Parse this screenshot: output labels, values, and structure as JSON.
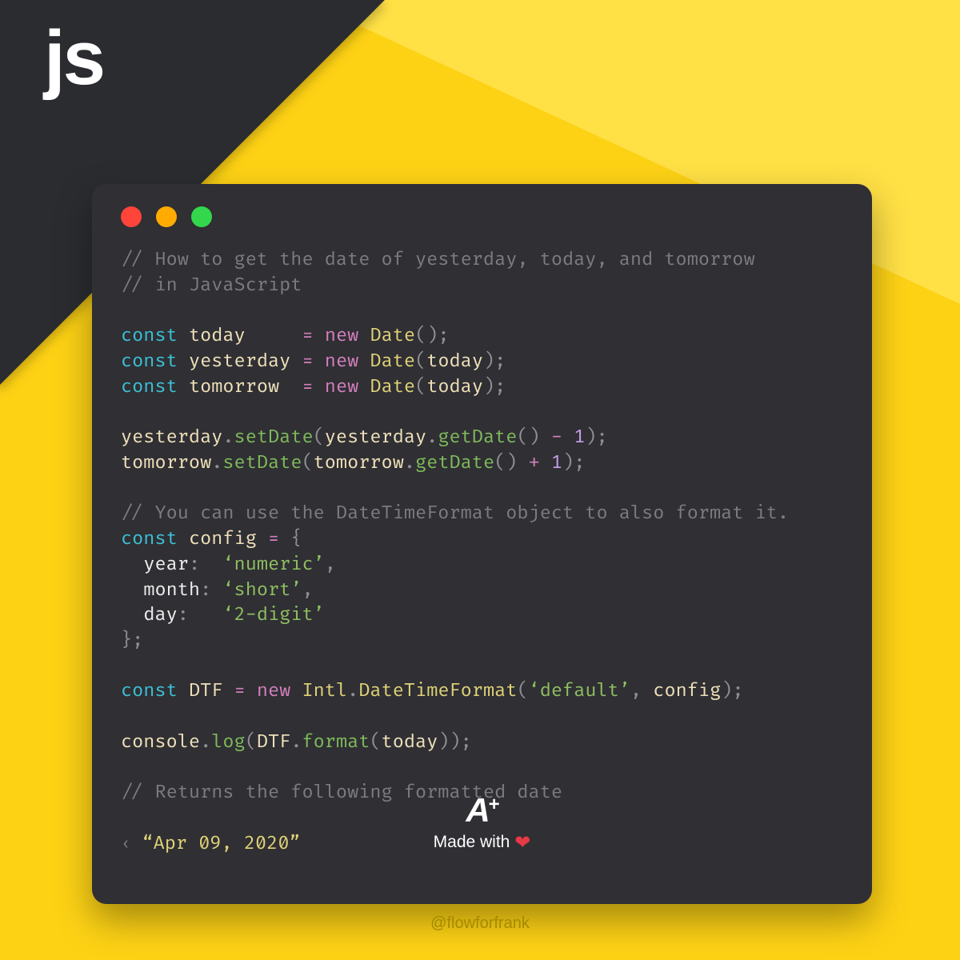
{
  "corner_label": "js",
  "comment1": "// How to get the date of yesterday, today, and tomorrow",
  "comment2": "// in JavaScript",
  "kw_const": "const",
  "id_today": "today",
  "id_yesterday": "yesterday",
  "id_tomorrow": "tomorrow",
  "id_config": "config",
  "id_DTF": "DTF",
  "id_console": "console",
  "id_Intl": "Intl",
  "kw_new": "new",
  "type_Date": "Date",
  "type_DateTimeFormat": "DateTimeFormat",
  "m_setDate": "setDate",
  "m_getDate": "getDate",
  "m_log": "log",
  "m_format": "format",
  "num_1": "1",
  "p_eq": "=",
  "p_minus": "-",
  "p_plus": "+",
  "p_dot": ".",
  "p_open": "(",
  "p_close": ")",
  "p_obrace": "{",
  "p_cbrace": "}",
  "p_semi": ";",
  "p_comma": ",",
  "p_colon": ":",
  "cfg_year_k": "year",
  "cfg_year_v": "‘numeric’",
  "cfg_month_k": "month",
  "cfg_month_v": "‘short’",
  "cfg_day_k": "day",
  "cfg_day_v": "‘2-digit’",
  "str_default": "‘default’",
  "comment3": "// You can use the DateTimeFormat object to also format it.",
  "comment4": "// Returns the following formatted date",
  "out_arrow": "‹",
  "out_value": "“Apr 09, 2020”",
  "footer_made": "Made with",
  "footer_aplus": "A",
  "footer_plus": "+",
  "handle": "@flowforfrank"
}
